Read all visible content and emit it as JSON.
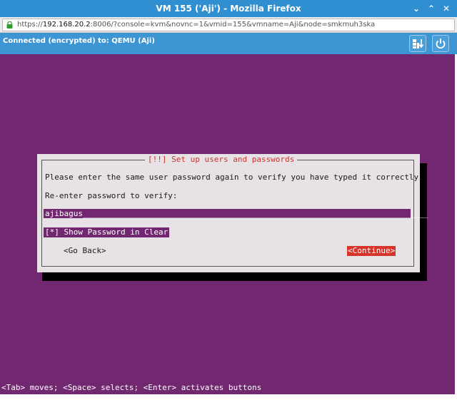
{
  "window": {
    "title": "VM 155 ('Aji') - Mozilla Firefox",
    "minimize_glyph": "⌄",
    "maximize_glyph": "⌃",
    "close_glyph": "✕"
  },
  "urlbar": {
    "scheme": "https://",
    "host": "192.168.20.2",
    "rest": ":8006/?console=kvm&novnc=1&vmid=155&vmname=Aji&node=smkmuh3ska"
  },
  "novnc": {
    "status": "Connected (encrypted) to: QEMU (Aji)"
  },
  "dialog": {
    "title": "[!!] Set up users and passwords",
    "prompt": "Please enter the same user password again to verify you have typed it correctly.",
    "label": "Re-enter password to verify:",
    "password_value": "ajibagus_________________________________________________________________________",
    "checkbox": "[*] Show Password in Clear",
    "go_back": "<Go Back>",
    "continue": "<Continue>"
  },
  "help_line": "<Tab> moves; <Space> selects; <Enter> activates buttons",
  "colors": {
    "titlebar": "#2f8fd1",
    "novnc_bar": "#3e95d3",
    "installer_bg": "#722870",
    "dialog_bg": "#e7e2e6",
    "accent_red": "#d8352a"
  }
}
